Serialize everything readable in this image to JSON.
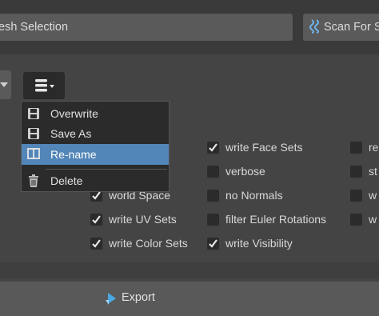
{
  "toolbar": {
    "mesh_selection_label": "esh Selection",
    "scan_label": "Scan For S"
  },
  "preset_menu": {
    "items": [
      {
        "label": "Overwrite",
        "icon": "save-icon",
        "selected": false
      },
      {
        "label": "Save As",
        "icon": "save-as-icon",
        "selected": false
      },
      {
        "label": "Re-name",
        "icon": "rename-icon",
        "selected": true
      },
      {
        "label": "Delete",
        "icon": "trash-icon",
        "selected": false
      }
    ]
  },
  "options": {
    "col1": [
      {
        "label": "world Space",
        "checked": true
      },
      {
        "label": "write UV Sets",
        "checked": true
      },
      {
        "label": "write Color Sets",
        "checked": true
      }
    ],
    "col2": [
      {
        "label": "write Face Sets",
        "checked": true
      },
      {
        "label": "verbose",
        "checked": false
      },
      {
        "label": "no Normals",
        "checked": false
      },
      {
        "label": "filter Euler Rotations",
        "checked": false
      },
      {
        "label": "write Visibility",
        "checked": true
      }
    ],
    "col3": [
      {
        "label": "re",
        "checked": false
      },
      {
        "label": "st",
        "checked": false
      },
      {
        "label": "w",
        "checked": false
      },
      {
        "label": "w",
        "checked": false
      }
    ]
  },
  "export": {
    "label": "Export"
  },
  "colors": {
    "accent": "#5286b8",
    "background": "#444444",
    "button": "#5a5a5a",
    "menu": "#2b2b2b"
  }
}
